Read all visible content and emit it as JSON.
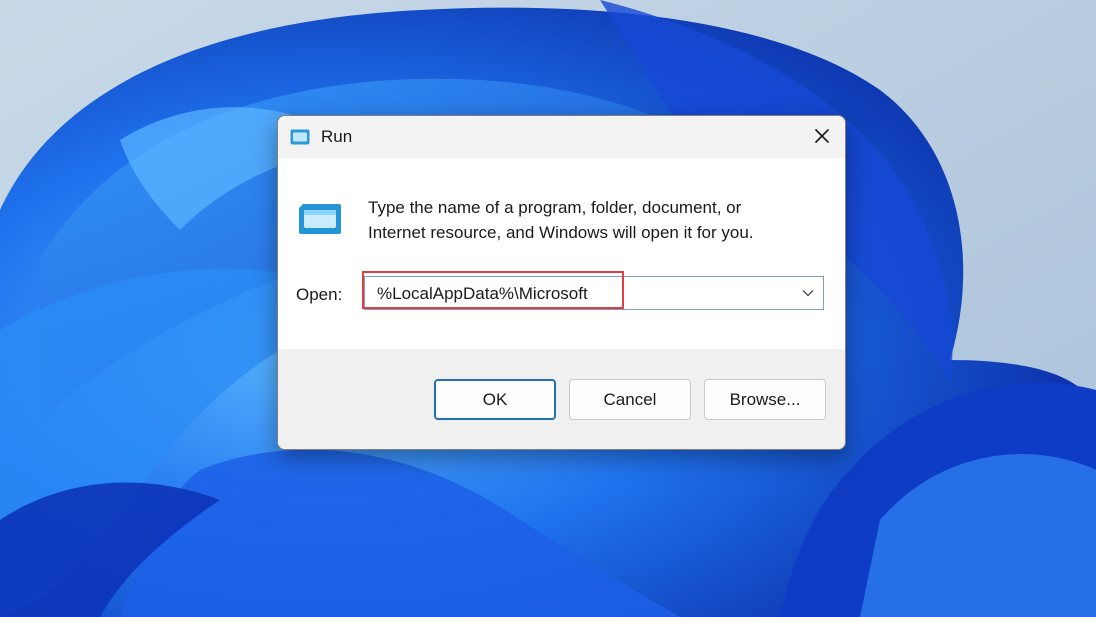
{
  "colors": {
    "desktop_bg": "#b9cde0",
    "bloom_blue": "#1f5fe0",
    "highlight_red": "#e0403e",
    "default_button_border": "#1f6fb2"
  },
  "desktop": {
    "wallpaper": "windows-11-bloom-wallpaper"
  },
  "dialog": {
    "title": "Run",
    "title_icon": "run-icon",
    "close_icon": "close-icon",
    "description_line1": "Type the name of a program, folder, document, or",
    "description_line2": "Internet resource, and Windows will open it for you.",
    "open_label": "Open:",
    "open_value": "%LocalAppData%\\Microsoft",
    "dropdown_icon": "chevron-down-icon",
    "buttons": {
      "ok": "OK",
      "cancel": "Cancel",
      "browse": "Browse..."
    }
  }
}
